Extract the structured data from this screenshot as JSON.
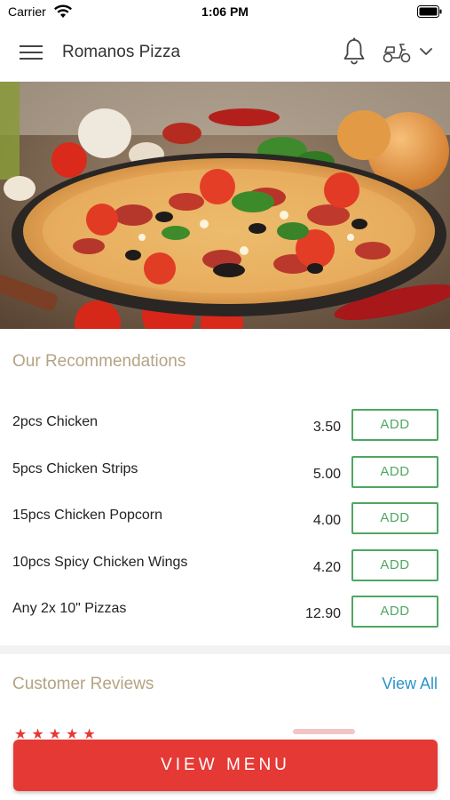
{
  "status_bar": {
    "carrier": "Carrier",
    "time": "1:06 PM"
  },
  "header": {
    "title": "Romanos Pizza"
  },
  "hero": {
    "image": "pizza-hero"
  },
  "recommendations": {
    "title": "Our Recommendations",
    "items": [
      {
        "name": "2pcs Chicken",
        "price": "3.50",
        "action": "ADD"
      },
      {
        "name": "5pcs Chicken Strips",
        "price": "5.00",
        "action": "ADD"
      },
      {
        "name": "15pcs Chicken Popcorn",
        "price": "4.00",
        "action": "ADD"
      },
      {
        "name": "10pcs Spicy Chicken Wings",
        "price": "4.20",
        "action": "ADD"
      },
      {
        "name": "Any 2x 10\" Pizzas",
        "price": "12.90",
        "action": "ADD"
      }
    ]
  },
  "reviews": {
    "title": "Customer Reviews",
    "view_all": "View All"
  },
  "footer": {
    "view_menu": "VIEW MENU"
  },
  "colors": {
    "accent_green": "#4ea763",
    "brand_red": "#e53935",
    "section_title_tan": "#b5a384",
    "link_blue": "#2b93c9"
  },
  "icons": [
    "wifi-icon",
    "battery-icon",
    "menu-icon",
    "bell-icon",
    "scooter-icon",
    "chevron-down-icon"
  ]
}
